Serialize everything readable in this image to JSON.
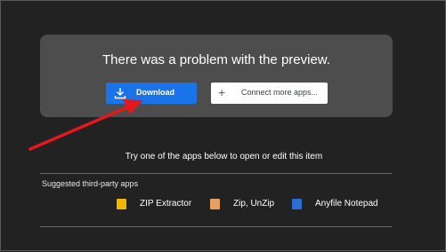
{
  "preview_card": {
    "title": "There was a problem with the preview.",
    "download_label": "Download",
    "connect_label": "Connect more apps...",
    "connect_icon": "+"
  },
  "try_text": "Try one of the apps below to open or edit this item",
  "suggested": {
    "heading": "Suggested third-party apps",
    "apps": [
      {
        "label": "ZIP Extractor",
        "icon": "zip-extractor-icon",
        "color": "#f2b700"
      },
      {
        "label": "Zip, UnZip",
        "icon": "zip-unzip-icon",
        "color": "#e8a060"
      },
      {
        "label": "Anyfile Notepad",
        "icon": "anyfile-notepad-icon",
        "color": "#2b6fd6"
      }
    ]
  },
  "colors": {
    "background": "#222222",
    "card": "#4d4d4d",
    "primary_button": "#1a73e8",
    "annotation_arrow": "#e3181c"
  }
}
